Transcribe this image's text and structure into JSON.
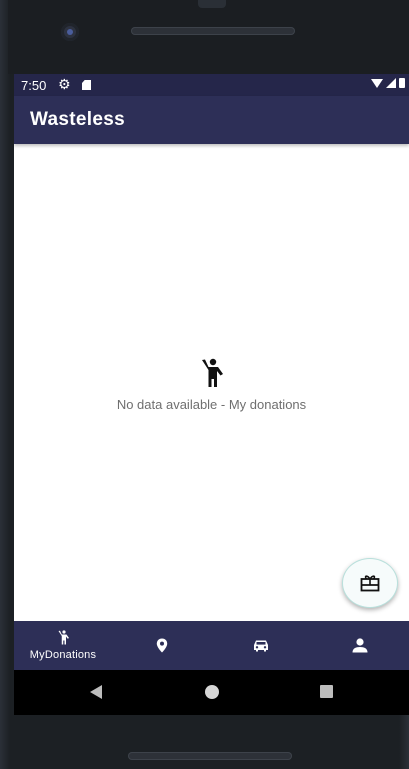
{
  "status_bar": {
    "time": "7:50",
    "icons": [
      "gear-icon",
      "sd-card-icon",
      "wifi-icon",
      "signal-icon",
      "battery-icon"
    ]
  },
  "app_bar": {
    "title": "Wasteless"
  },
  "empty_state": {
    "icon": "person-waving-icon",
    "message": "No data available - My donations"
  },
  "fab": {
    "icon": "gift-card-icon"
  },
  "bottom_nav": {
    "items": [
      {
        "label": "MyDonations",
        "icon": "person-waving-icon",
        "active": true
      },
      {
        "label": "",
        "icon": "map-pin-icon",
        "active": false
      },
      {
        "label": "",
        "icon": "car-icon",
        "active": false
      },
      {
        "label": "",
        "icon": "person-icon",
        "active": false
      }
    ]
  },
  "colors": {
    "status_bar": "#25264a",
    "app_bar": "#2d2f57",
    "bottom_nav": "#2d2f57",
    "fab_bg": "#f6fbfb",
    "empty_text": "#6f6f6f"
  }
}
